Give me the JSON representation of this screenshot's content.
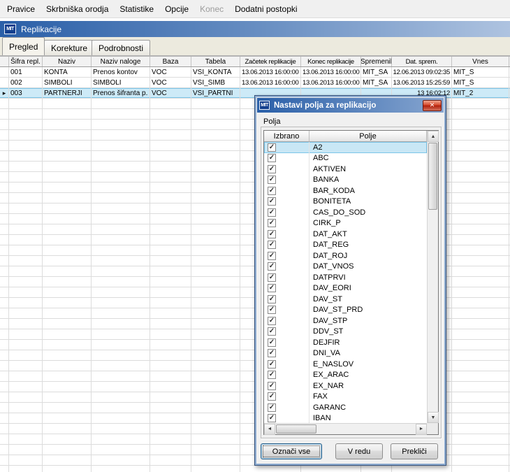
{
  "menu_bar": {
    "items": [
      {
        "label": "Pravice",
        "enabled": true
      },
      {
        "label": "Skrbniška orodja",
        "enabled": true
      },
      {
        "label": "Statistike",
        "enabled": true
      },
      {
        "label": "Opcije",
        "enabled": true
      },
      {
        "label": "Konec",
        "enabled": false
      },
      {
        "label": "Dodatni postopki",
        "enabled": true
      }
    ]
  },
  "window": {
    "title": "Replikacije",
    "logo_text": "MIT"
  },
  "tabs": [
    {
      "label": "Pregled",
      "active": true
    },
    {
      "label": "Korekture",
      "active": false
    },
    {
      "label": "Podrobnosti",
      "active": false
    }
  ],
  "grid": {
    "columns": [
      "",
      "Šifra repl.",
      "Naziv",
      "Naziv naloge",
      "Baza",
      "Tabela",
      "Začetek replikacije",
      "Konec replikacije",
      "Spremenil",
      "Dat. sprem.",
      "Vnes"
    ],
    "rows": [
      {
        "selected": false,
        "cells": [
          "",
          "001",
          "KONTA",
          "Prenos kontov",
          "VOC",
          "VSI_KONTA",
          "13.06.2013 16:00:00",
          "13.06.2013 16:00:00",
          "MIT_SA",
          "12.06.2013 09:02:35",
          "MIT_S"
        ]
      },
      {
        "selected": false,
        "cells": [
          "",
          "002",
          "SIMBOLI",
          "SIMBOLI",
          "VOC",
          "VSI_SIMB",
          "13.06.2013 16:00:00",
          "13.06.2013 16:00:00",
          "MIT_SA",
          "13.06.2013 15:25:59",
          "MIT_S"
        ]
      },
      {
        "selected": true,
        "cells": [
          "",
          "003",
          "PARTNERJI",
          "Prenos šifranta p.",
          "VOC",
          "VSI_PARTNI",
          "",
          "",
          "",
          "13 16:02:12",
          "MIT_2"
        ]
      }
    ]
  },
  "dialog": {
    "title": "Nastavi polja za replikacijo",
    "logo_text": "MIT",
    "group_label": "Polja",
    "list": {
      "columns": [
        "Izbrano",
        "Polje"
      ],
      "selected_index": 0,
      "rows": [
        {
          "checked": true,
          "field": "A2"
        },
        {
          "checked": true,
          "field": "ABC"
        },
        {
          "checked": true,
          "field": "AKTIVEN"
        },
        {
          "checked": true,
          "field": "BANKA"
        },
        {
          "checked": true,
          "field": "BAR_KODA"
        },
        {
          "checked": true,
          "field": "BONITETA"
        },
        {
          "checked": true,
          "field": "CAS_DO_SOD"
        },
        {
          "checked": true,
          "field": "CIRK_P"
        },
        {
          "checked": true,
          "field": "DAT_AKT"
        },
        {
          "checked": true,
          "field": "DAT_REG"
        },
        {
          "checked": true,
          "field": "DAT_ROJ"
        },
        {
          "checked": true,
          "field": "DAT_VNOS"
        },
        {
          "checked": true,
          "field": "DATPRVI"
        },
        {
          "checked": true,
          "field": "DAV_EORI"
        },
        {
          "checked": true,
          "field": "DAV_ST"
        },
        {
          "checked": true,
          "field": "DAV_ST_PRD"
        },
        {
          "checked": true,
          "field": "DAV_STP"
        },
        {
          "checked": true,
          "field": "DDV_ST"
        },
        {
          "checked": true,
          "field": "DEJFIR"
        },
        {
          "checked": true,
          "field": "DNI_VA"
        },
        {
          "checked": true,
          "field": "E_NASLOV"
        },
        {
          "checked": true,
          "field": "EX_ARAC"
        },
        {
          "checked": true,
          "field": "EX_NAR"
        },
        {
          "checked": true,
          "field": "FAX"
        },
        {
          "checked": true,
          "field": "GARANC"
        },
        {
          "checked": true,
          "field": "IBAN"
        }
      ]
    },
    "buttons": [
      {
        "label": "Označi vse",
        "default": true
      },
      {
        "label": "V redu",
        "default": false
      },
      {
        "label": "Prekliči",
        "default": false
      }
    ]
  },
  "icons": {
    "close": "✕",
    "scroll_up": "▲",
    "scroll_down": "▼",
    "scroll_left": "◄",
    "scroll_right": "►",
    "row_marker": "▸",
    "check": "✓"
  },
  "colors": {
    "titlebar_left": "#2a5fa8",
    "titlebar_right": "#aec3e0",
    "selection_bg": "#cdeaf7",
    "selection_border": "#7cc5e8",
    "close_button_red": "#b01e0a"
  }
}
